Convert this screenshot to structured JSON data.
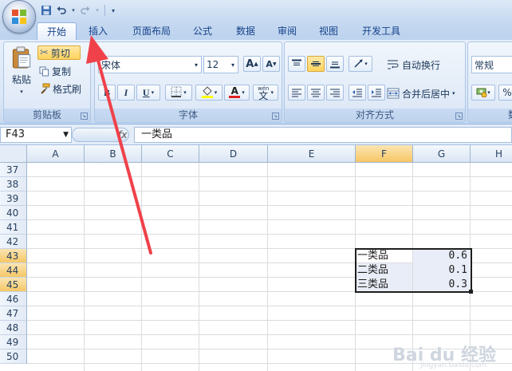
{
  "quick_access": {
    "save": "save-icon",
    "undo": "undo-icon",
    "redo": "redo-icon"
  },
  "tabs": [
    "开始",
    "插入",
    "页面布局",
    "公式",
    "数据",
    "审阅",
    "视图",
    "开发工具"
  ],
  "ribbon": {
    "clipboard": {
      "paste": "粘贴",
      "cut": "剪切",
      "copy": "复制",
      "format_painter": "格式刷",
      "label": "剪贴板"
    },
    "font": {
      "name": "宋体",
      "size": "12",
      "bold": "B",
      "italic": "I",
      "underline": "U",
      "phonetic": "wén",
      "phonetic_sub": "文",
      "grow": "A",
      "shrink": "A",
      "font_color": "A",
      "label": "字体"
    },
    "alignment": {
      "wrap_text": "自动换行",
      "merge_center": "合并后居中",
      "label": "对齐方式"
    },
    "number": {
      "format": "常规",
      "percent": "%",
      "label": "数"
    }
  },
  "formula_bar": {
    "cell_ref": "F43",
    "fx": "fx",
    "content": "一类品"
  },
  "columns": [
    "A",
    "B",
    "C",
    "D",
    "E",
    "F",
    "G",
    "H"
  ],
  "rows": [
    "37",
    "38",
    "39",
    "40",
    "41",
    "42",
    "43",
    "44",
    "45",
    "46",
    "47",
    "48",
    "49",
    "50"
  ],
  "cells": {
    "F43": "一类品",
    "G43": "0.6",
    "F44": "二类品",
    "G44": "0.1",
    "F45": "三类品",
    "G45": "0.3"
  },
  "watermark": {
    "main": "Bai du 经验",
    "sub": "jingyan.baidu.com"
  },
  "colors": {
    "annotation_arrow": "#f0414a",
    "header_highlight": "#f6c765"
  }
}
